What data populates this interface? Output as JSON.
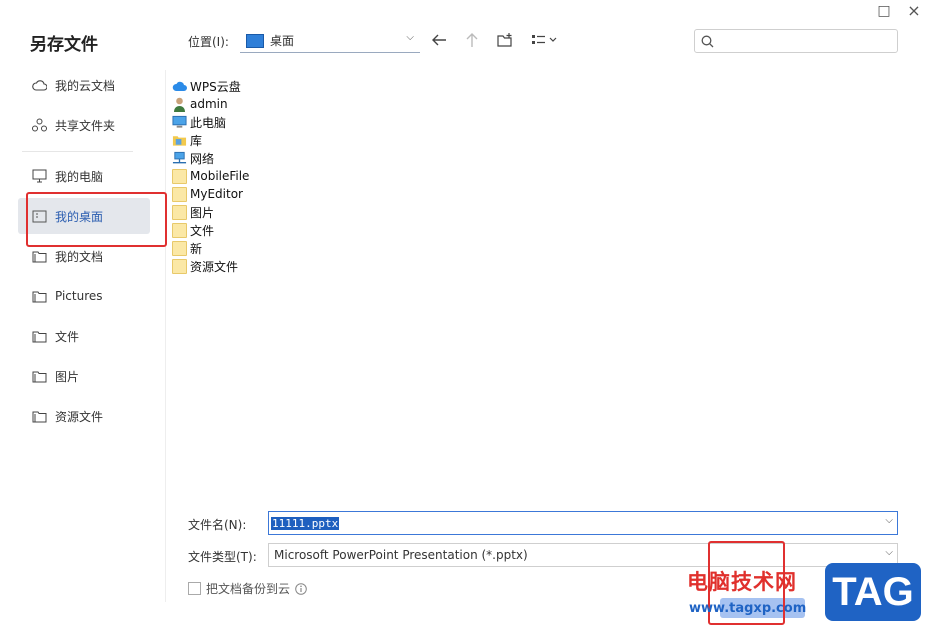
{
  "window": {
    "maximize_icon": "□",
    "close_icon": "×"
  },
  "title": "另存文件",
  "sidebar": {
    "items": [
      {
        "label": "我的云文档",
        "icon": "cloud-icon"
      },
      {
        "label": "共享文件夹",
        "icon": "share-icon"
      },
      {
        "label": "我的电脑",
        "icon": "monitor-icon"
      },
      {
        "label": "我的桌面",
        "icon": "desktop-icon"
      },
      {
        "label": "我的文档",
        "icon": "folder-icon"
      },
      {
        "label": "Pictures",
        "icon": "folder-icon"
      },
      {
        "label": "文件",
        "icon": "folder-icon"
      },
      {
        "label": "图片",
        "icon": "folder-icon"
      },
      {
        "label": "资源文件",
        "icon": "folder-icon"
      }
    ],
    "active_index": 3
  },
  "toolbar": {
    "location_label": "位置(I):",
    "location_value": "桌面",
    "search_placeholder": ""
  },
  "files": [
    {
      "name": "WPS云盘",
      "icon": "wps-cloud-icon"
    },
    {
      "name": "admin",
      "icon": "user-icon"
    },
    {
      "name": "此电脑",
      "icon": "computer-icon"
    },
    {
      "name": "库",
      "icon": "library-icon"
    },
    {
      "name": "网络",
      "icon": "network-icon"
    },
    {
      "name": "MobileFile",
      "icon": "folder-icon"
    },
    {
      "name": "MyEditor",
      "icon": "folder-icon"
    },
    {
      "name": "图片",
      "icon": "folder-icon"
    },
    {
      "name": "文件",
      "icon": "folder-icon"
    },
    {
      "name": "新",
      "icon": "folder-icon"
    },
    {
      "name": "资源文件",
      "icon": "folder-icon"
    }
  ],
  "form": {
    "filename_label": "文件名(N):",
    "filename_value": "11111.pptx",
    "filetype_label": "文件类型(T):",
    "filetype_value": "Microsoft PowerPoint Presentation (*.pptx)",
    "backup_label": "把文档备份到云",
    "backup_checked": false
  },
  "watermark": {
    "text": "电脑技术网",
    "url": "www.tagxp.com",
    "logo": "TAG"
  },
  "colors": {
    "accent": "#2a5db0",
    "highlight": "#e03030",
    "selection": "#1e5fbf"
  }
}
